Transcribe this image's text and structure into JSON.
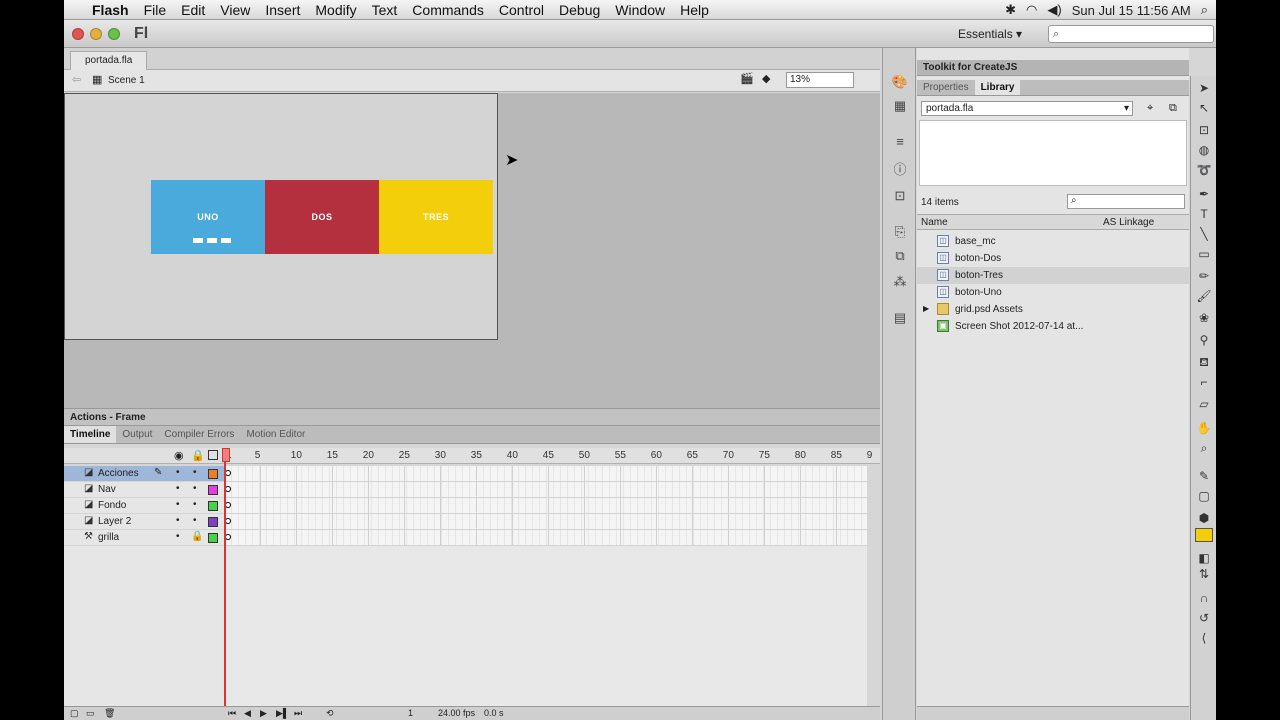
{
  "menubar": {
    "apple": "",
    "app": "Flash",
    "items": [
      "File",
      "Edit",
      "View",
      "Insert",
      "Modify",
      "Text",
      "Commands",
      "Control",
      "Debug",
      "Window",
      "Help"
    ],
    "clock": "Sun Jul 15  11:56 AM"
  },
  "app": {
    "logo": "Fl",
    "workspace": "Essentials",
    "search_placeholder": ""
  },
  "document": {
    "tab": "portada.fla",
    "scene": "Scene 1",
    "zoom": "13%"
  },
  "stage": {
    "boxes": [
      {
        "label": "UNO",
        "color": "#4aaadc"
      },
      {
        "label": "DOS",
        "color": "#b5303f"
      },
      {
        "label": "TRES",
        "color": "#f3cf0b"
      }
    ]
  },
  "panels": {
    "actions": "Actions - Frame",
    "timeline_tabs": [
      "Timeline",
      "Output",
      "Compiler Errors",
      "Motion Editor"
    ]
  },
  "timeline": {
    "ruler": [
      "1",
      "5",
      "10",
      "15",
      "20",
      "25",
      "30",
      "35",
      "40",
      "45",
      "50",
      "55",
      "60",
      "65",
      "70",
      "75",
      "80",
      "85",
      "9"
    ],
    "layers": [
      {
        "name": "Acciones",
        "color": "#e87f2e",
        "selected": true
      },
      {
        "name": "Nav",
        "color": "#e040e0",
        "selected": false
      },
      {
        "name": "Fondo",
        "color": "#4bd04b",
        "selected": false
      },
      {
        "name": "Layer 2",
        "color": "#8040c0",
        "selected": false
      },
      {
        "name": "grilla",
        "color": "#4bd04b",
        "selected": false
      }
    ],
    "current_frame": "1",
    "fps": "24.00 fps",
    "time": "0.0 s"
  },
  "library": {
    "toolkit": "Toolkit for CreateJS",
    "tabs": [
      "Properties",
      "Library"
    ],
    "document": "portada.fla",
    "count": "14 items",
    "col_name": "Name",
    "col_linkage": "AS Linkage",
    "items": [
      {
        "name": "base_mc",
        "type": "symbol"
      },
      {
        "name": "boton-Dos",
        "type": "symbol"
      },
      {
        "name": "boton-Tres",
        "type": "symbol",
        "selected": true
      },
      {
        "name": "boton-Uno",
        "type": "symbol"
      },
      {
        "name": "grid.psd Assets",
        "type": "folder"
      },
      {
        "name": "Screen Shot 2012-07-14 at...",
        "type": "image"
      }
    ]
  }
}
